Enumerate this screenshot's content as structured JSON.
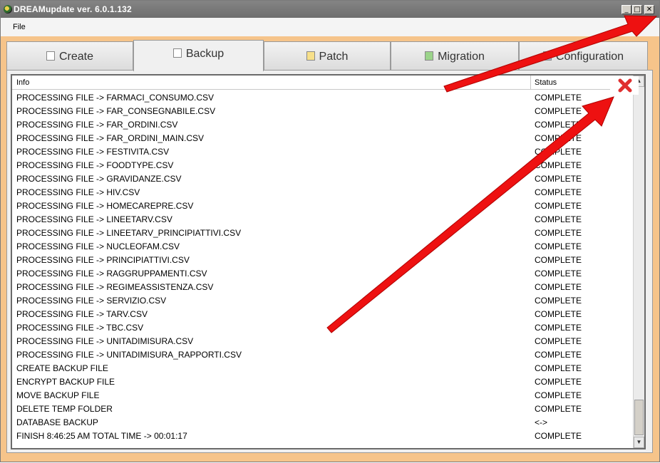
{
  "window": {
    "title": "DREAMupdate ver. 6.0.1.132",
    "controls": {
      "minimize": "_",
      "maximize": "□",
      "close": "✕"
    }
  },
  "menu": {
    "file": "File"
  },
  "tabs": [
    {
      "label": "Create",
      "icon": "create-icon"
    },
    {
      "label": "Backup",
      "icon": "backup-icon"
    },
    {
      "label": "Patch",
      "icon": "patch-icon"
    },
    {
      "label": "Migration",
      "icon": "migration-icon"
    },
    {
      "label": "Configuration",
      "icon": "configuration-icon"
    }
  ],
  "active_tab": "Backup",
  "list": {
    "columns": {
      "info": "Info",
      "status": "Status"
    },
    "rows": [
      {
        "info": "PROCESSING FILE -> FARMACI_CONSUMO.CSV",
        "status": "COMPLETE"
      },
      {
        "info": "PROCESSING FILE -> FAR_CONSEGNABILE.CSV",
        "status": "COMPLETE"
      },
      {
        "info": "PROCESSING FILE -> FAR_ORDINI.CSV",
        "status": "COMPLETE"
      },
      {
        "info": "PROCESSING FILE -> FAR_ORDINI_MAIN.CSV",
        "status": "COMPLETE"
      },
      {
        "info": "PROCESSING FILE -> FESTIVITA.CSV",
        "status": "COMPLETE"
      },
      {
        "info": "PROCESSING FILE -> FOODTYPE.CSV",
        "status": "COMPLETE"
      },
      {
        "info": "PROCESSING FILE -> GRAVIDANZE.CSV",
        "status": "COMPLETE"
      },
      {
        "info": "PROCESSING FILE -> HIV.CSV",
        "status": "COMPLETE"
      },
      {
        "info": "PROCESSING FILE -> HOMECAREPRE.CSV",
        "status": "COMPLETE"
      },
      {
        "info": "PROCESSING FILE -> LINEETARV.CSV",
        "status": "COMPLETE"
      },
      {
        "info": "PROCESSING FILE -> LINEETARV_PRINCIPIATTIVI.CSV",
        "status": "COMPLETE"
      },
      {
        "info": "PROCESSING FILE -> NUCLEOFAM.CSV",
        "status": "COMPLETE"
      },
      {
        "info": "PROCESSING FILE -> PRINCIPIATTIVI.CSV",
        "status": "COMPLETE"
      },
      {
        "info": "PROCESSING FILE -> RAGGRUPPAMENTI.CSV",
        "status": "COMPLETE"
      },
      {
        "info": "PROCESSING FILE -> REGIMEASSISTENZA.CSV",
        "status": "COMPLETE"
      },
      {
        "info": "PROCESSING FILE -> SERVIZIO.CSV",
        "status": "COMPLETE"
      },
      {
        "info": "PROCESSING FILE -> TARV.CSV",
        "status": "COMPLETE"
      },
      {
        "info": "PROCESSING FILE -> TBC.CSV",
        "status": "COMPLETE"
      },
      {
        "info": "PROCESSING FILE -> UNITADIMISURA.CSV",
        "status": "COMPLETE"
      },
      {
        "info": "PROCESSING FILE -> UNITADIMISURA_RAPPORTI.CSV",
        "status": "COMPLETE"
      },
      {
        "info": "CREATE BACKUP FILE",
        "status": "COMPLETE"
      },
      {
        "info": "ENCRYPT BACKUP FILE",
        "status": "COMPLETE"
      },
      {
        "info": "MOVE BACKUP FILE",
        "status": "COMPLETE"
      },
      {
        "info": "DELETE TEMP FOLDER",
        "status": "COMPLETE"
      },
      {
        "info": "DATABASE BACKUP",
        "status": "<->"
      },
      {
        "info": "FINISH 8:46:25 AM TOTAL TIME -> 00:01:17",
        "status": "COMPLETE"
      }
    ]
  },
  "annotation": {
    "x_mark": "✖",
    "arrow_color": "#ee1111"
  },
  "colors": {
    "titlebar": "#7a7a7a",
    "frame": "#f6c48a",
    "x_mark": "#e03030"
  }
}
